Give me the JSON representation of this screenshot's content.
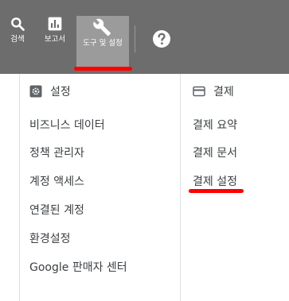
{
  "toolbar": {
    "search_label": "검색",
    "reports_label": "보고서",
    "tools_label": "도구 및 설정"
  },
  "menu": {
    "settings": {
      "title": "설정",
      "items": [
        "비즈니스 데이터",
        "정책 관리자",
        "계정 액세스",
        "연결된 계정",
        "환경설정",
        "Google 판매자 센터"
      ]
    },
    "billing": {
      "title": "결제",
      "items": [
        "결제 요약",
        "결제 문서",
        "결제 설정"
      ]
    }
  },
  "colors": {
    "toolbar_bg": "#6d6d6d",
    "active_tab_bg": "#9b9b9b",
    "highlight": "#ff0000"
  }
}
